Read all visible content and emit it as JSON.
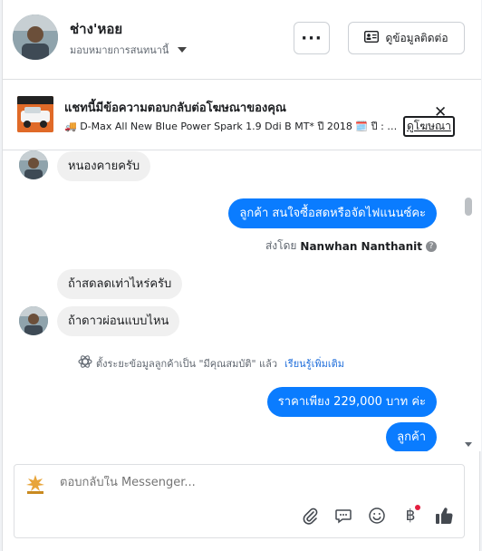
{
  "header": {
    "contact_name": "ช่าง'หอย",
    "assign_label": "มอบหมายการสนทนานี้",
    "more_label": "···",
    "contact_info_label": "ดูข้อมูลติดต่อ"
  },
  "ad_banner": {
    "title": "แชทนี้มีข้อความตอบกลับต่อโฆษณาของคุณ",
    "description": "🚚 D-Max All New Blue Power Spark 1.9 Ddi B MT* ปี 2018 🗓️ ปี : 2...",
    "view_ad_label": "ดูโฆษณา",
    "close_label": "✕"
  },
  "messages": [
    {
      "direction": "in",
      "text": "หนองคายครับ"
    },
    {
      "direction": "out",
      "text": "ลูกค้า สนใจซื้อสดหรือจัดไฟแนนซ์คะ"
    },
    {
      "direction": "in",
      "text": "ถ้าสดลดเท่าไหร่ครับ"
    },
    {
      "direction": "in",
      "text": "ถ้าดาวผ่อนแบบไหน"
    },
    {
      "direction": "out",
      "text": "ราคาเพียง 229,000 บาท ค่ะ"
    },
    {
      "direction": "out",
      "text": "ลูกค้า"
    }
  ],
  "sent_by": {
    "prefix": "ส่งโดย",
    "name": "Nanwhan Nanthanit"
  },
  "system_notice": {
    "text": "ตั้งระยะข้อมูลลูกค้าเป็น \"มีคุณสมบัติ\" แล้ว",
    "link": "เรียนรู้เพิ่มเติม"
  },
  "composer": {
    "placeholder": "ตอบกลับใน Messenger...",
    "icons": [
      "paperclip-icon",
      "chat-bubble-icon",
      "emoji-icon",
      "baht-icon",
      "thumbs-up-icon"
    ]
  },
  "colors": {
    "accent": "#0a7cff",
    "incoming_bubble": "#f0f0f0",
    "link": "#216fdb"
  }
}
